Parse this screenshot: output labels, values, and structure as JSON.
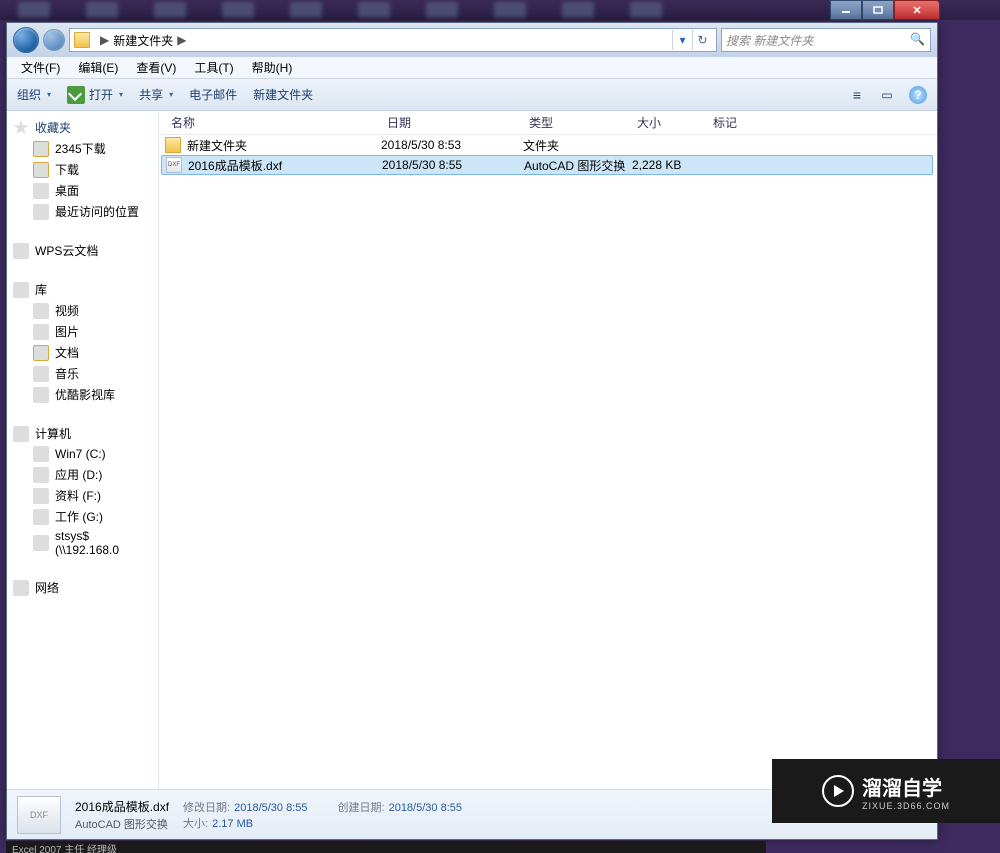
{
  "window_controls": {
    "min": "–",
    "max": "❐",
    "close": "✕"
  },
  "address": {
    "root_sep": "▶",
    "folder": "新建文件夹",
    "crumb_sep": "▶",
    "refresh": "↻"
  },
  "search": {
    "placeholder": "搜索 新建文件夹"
  },
  "menu": {
    "file": "文件(F)",
    "edit": "编辑(E)",
    "view": "查看(V)",
    "tools": "工具(T)",
    "help": "帮助(H)"
  },
  "toolbar": {
    "organize": "组织",
    "open": "打开",
    "share": "共享",
    "email": "电子邮件",
    "newfolder": "新建文件夹",
    "view_icon": "≡",
    "pane_icon": "▭",
    "help_icon": "?"
  },
  "nav": {
    "favorites": "收藏夹",
    "fav_items": [
      "2345下载",
      "下载",
      "桌面",
      "最近访问的位置"
    ],
    "wps": "WPS云文档",
    "libraries": "库",
    "lib_items": [
      "视频",
      "图片",
      "文档",
      "音乐",
      "优酷影视库"
    ],
    "computer": "计算机",
    "drives": [
      "Win7 (C:)",
      "应用 (D:)",
      "资料 (F:)",
      "工作 (G:)",
      "stsys$ (\\\\192.168.0"
    ],
    "network": "网络"
  },
  "columns": {
    "name": "名称",
    "date": "日期",
    "type": "类型",
    "size": "大小",
    "tags": "标记"
  },
  "rows": [
    {
      "icon": "folder",
      "name": "新建文件夹",
      "date": "2018/5/30 8:53",
      "type": "文件夹",
      "size": ""
    },
    {
      "icon": "dxf",
      "name": "2016成品模板.dxf",
      "date": "2018/5/30 8:55",
      "type": "AutoCAD 图形交换",
      "size": "2,228 KB",
      "selected": true
    }
  ],
  "details": {
    "thumb": "DXF",
    "filename": "2016成品模板.dxf",
    "filetype": "AutoCAD 图形交换",
    "mod_label": "修改日期:",
    "mod_val": "2018/5/30 8:55",
    "size_label": "大小:",
    "size_val": "2.17 MB",
    "create_label": "创建日期:",
    "create_val": "2018/5/30 8:55"
  },
  "watermark": {
    "title": "溜溜自学",
    "sub": "ZIXUE.3D66.COM"
  },
  "bottom": "Excel 2007  主任  经理级"
}
